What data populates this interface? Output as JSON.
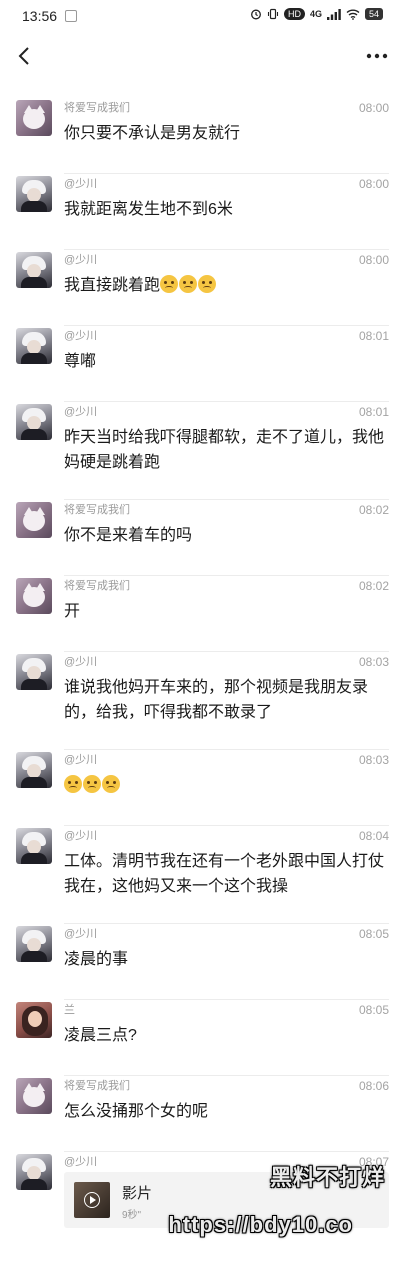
{
  "status_bar": {
    "time": "13:56",
    "indicators": [
      "alarm-icon",
      "vibrate-icon",
      "HD",
      "4G",
      "signal-icon",
      "wifi-icon"
    ],
    "hd_label": "HD",
    "network_label": "4G",
    "battery": "54"
  },
  "nav": {
    "back_icon": "chevron-left-icon",
    "more_icon": "more-dots-icon"
  },
  "messages": [
    {
      "sender": "将爱写成我们",
      "avatar": "cat",
      "time": "08:00",
      "text": "你只要不承认是男友就行"
    },
    {
      "sender": "@少川",
      "avatar": "shao",
      "time": "08:00",
      "text": "我就距离发生地不到6米"
    },
    {
      "sender": "@少川",
      "avatar": "shao",
      "time": "08:00",
      "text": "我直接跳着跑",
      "emoji_count": 3
    },
    {
      "sender": "@少川",
      "avatar": "shao",
      "time": "08:01",
      "text": "尊嘟"
    },
    {
      "sender": "@少川",
      "avatar": "shao",
      "time": "08:01",
      "text": "昨天当时给我吓得腿都软，走不了道儿，我他妈硬是跳着跑"
    },
    {
      "sender": "将爱写成我们",
      "avatar": "cat",
      "time": "08:02",
      "text": "你不是来着车的吗"
    },
    {
      "sender": "将爱写成我们",
      "avatar": "cat",
      "time": "08:02",
      "text": "开"
    },
    {
      "sender": "@少川",
      "avatar": "shao",
      "time": "08:03",
      "text": "谁说我他妈开车来的，那个视频是我朋友录的，给我，吓得我都不敢录了"
    },
    {
      "sender": "@少川",
      "avatar": "shao",
      "time": "08:03",
      "text": "",
      "emoji_count": 3
    },
    {
      "sender": "@少川",
      "avatar": "shao",
      "time": "08:04",
      "text": "工体。清明节我在还有一个老外跟中国人打仗我在，这他妈又来一个这个我操"
    },
    {
      "sender": "@少川",
      "avatar": "shao",
      "time": "08:05",
      "text": "凌晨的事"
    },
    {
      "sender": "兰",
      "avatar": "lan",
      "time": "08:05",
      "text": "凌晨三点?"
    },
    {
      "sender": "将爱写成我们",
      "avatar": "cat",
      "time": "08:06",
      "text": "怎么没捅那个女的呢"
    },
    {
      "sender": "@少川",
      "avatar": "shao",
      "time": "08:07",
      "video": {
        "title": "影片",
        "duration": "9秒\""
      }
    }
  ],
  "watermark": {
    "line1": "黑料不打烊",
    "line2": "https://bdy10.co"
  }
}
